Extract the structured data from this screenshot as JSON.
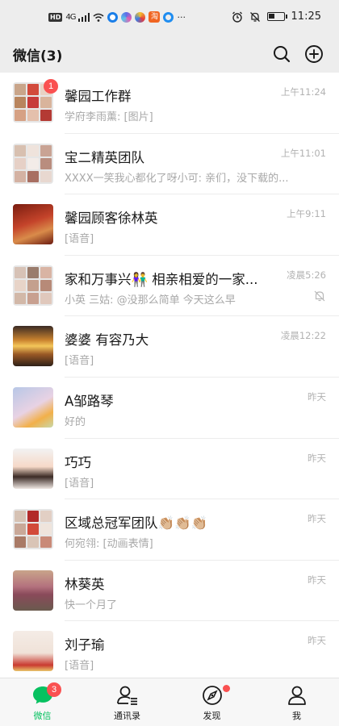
{
  "status_bar": {
    "network_badge": "HD",
    "network_gen": "4G",
    "time": "11:25",
    "battery_level": 0.45,
    "app_icons": [
      "ring-app-icon",
      "pinwheel-app-icon",
      "browser-app-icon",
      "taobao-app-icon",
      "blue-ring-app-icon"
    ],
    "taobao_glyph": "淘",
    "more": "···"
  },
  "header": {
    "title": "微信(3)",
    "search_icon": "search-icon",
    "add_icon": "add-circle-icon"
  },
  "chats": [
    {
      "name": "馨园工作群",
      "preview": "学府李雨薰: [图片]",
      "time": "上午11:24",
      "badge": "1",
      "avatar_type": "group",
      "avatar_colors": [
        "#c9a58a",
        "#d24a3c",
        "#e9d2c4",
        "#b9855e",
        "#c73b3b",
        "#d9b49c",
        "#d6a184",
        "#e4c0ac",
        "#b43a34"
      ]
    },
    {
      "name": "宝二精英团队",
      "preview": "XXXX一笑我心都化了呀小可: 亲们，没下载的...",
      "time": "上午11:01",
      "avatar_type": "group",
      "avatar_colors": [
        "#d8c0b0",
        "#efe3dc",
        "#c9a394",
        "#e6d0c6",
        "#f3ece8",
        "#b98d7e",
        "#d4b2a3",
        "#a86f62",
        "#e8d8d0"
      ]
    },
    {
      "name": "馨园顾客徐林英",
      "preview": "[语音]",
      "time": "上午9:11",
      "avatar_type": "photo",
      "avatar_gradient": "linear-gradient(160deg,#7a1d10 0%,#c4432a 45%,#d98b4a 70%,#6b1a10 100%)"
    },
    {
      "name": "家和万事兴👫 相亲相爱的一家...",
      "preview": "小英   三姑: @没那么简单 今天这么早",
      "time": "凌晨5:26",
      "muted": true,
      "avatar_type": "group",
      "avatar_colors": [
        "#d7c2b6",
        "#9a7c6c",
        "#d9b4a4",
        "#e8d4c8",
        "#c4a08e",
        "#b78a78",
        "#d2b8a8",
        "#c8a090",
        "#e0c8bc"
      ]
    },
    {
      "name": "婆婆  有容乃大",
      "preview": "[语音]",
      "time": "凌晨12:22",
      "avatar_type": "photo",
      "avatar_gradient": "linear-gradient(180deg,#3a2a24 0%,#c9822e 35%,#f4c65a 50%,#9b5a26 70%,#2e2018 100%)"
    },
    {
      "name": "A邹路琴",
      "preview": "好的",
      "time": "昨天",
      "avatar_type": "photo",
      "avatar_gradient": "linear-gradient(150deg,#b7c7e6 0%,#e8d2e4 50%,#f2b04a 75%,#c9d8a8 100%)"
    },
    {
      "name": "巧巧",
      "preview": "[语音]",
      "time": "昨天",
      "avatar_type": "photo",
      "avatar_gradient": "linear-gradient(180deg,#f2f2f2 0%,#f6d9c8 45%,#3b2b26 70%,#efe7e2 100%)"
    },
    {
      "name": "区域总冠军团队👏🏼👏🏼👏🏼",
      "preview": "何宛翎: [动画表情]",
      "time": "昨天",
      "avatar_type": "group",
      "avatar_colors": [
        "#d6c2b4",
        "#b22a2a",
        "#e2cfc4",
        "#c9a898",
        "#d24a3a",
        "#efe4dc",
        "#a97a66",
        "#d9c4b6",
        "#c98a78"
      ]
    },
    {
      "name": "林葵英",
      "preview": "快一个月了",
      "time": "昨天",
      "avatar_type": "photo",
      "avatar_gradient": "linear-gradient(180deg,#c9a48a 0%,#b4727e 40%,#8a4a5a 60%,#6a5a4e 100%)"
    },
    {
      "name": "刘子瑜",
      "preview": "[语音]",
      "time": "昨天",
      "avatar_type": "photo",
      "avatar_gradient": "linear-gradient(180deg,#f4ece6 0%,#f0e2d8 55%,#c93a30 85%,#e8c46a 100%)"
    }
  ],
  "tabs": [
    {
      "label": "微信",
      "icon": "chat-bubble-icon",
      "active": true,
      "badge": "3"
    },
    {
      "label": "通讯录",
      "icon": "contacts-icon"
    },
    {
      "label": "发现",
      "icon": "compass-icon",
      "dot": true
    },
    {
      "label": "我",
      "icon": "person-icon"
    }
  ],
  "colors": {
    "accent": "#07c160",
    "badge": "#fa5151",
    "background": "#ededed"
  }
}
